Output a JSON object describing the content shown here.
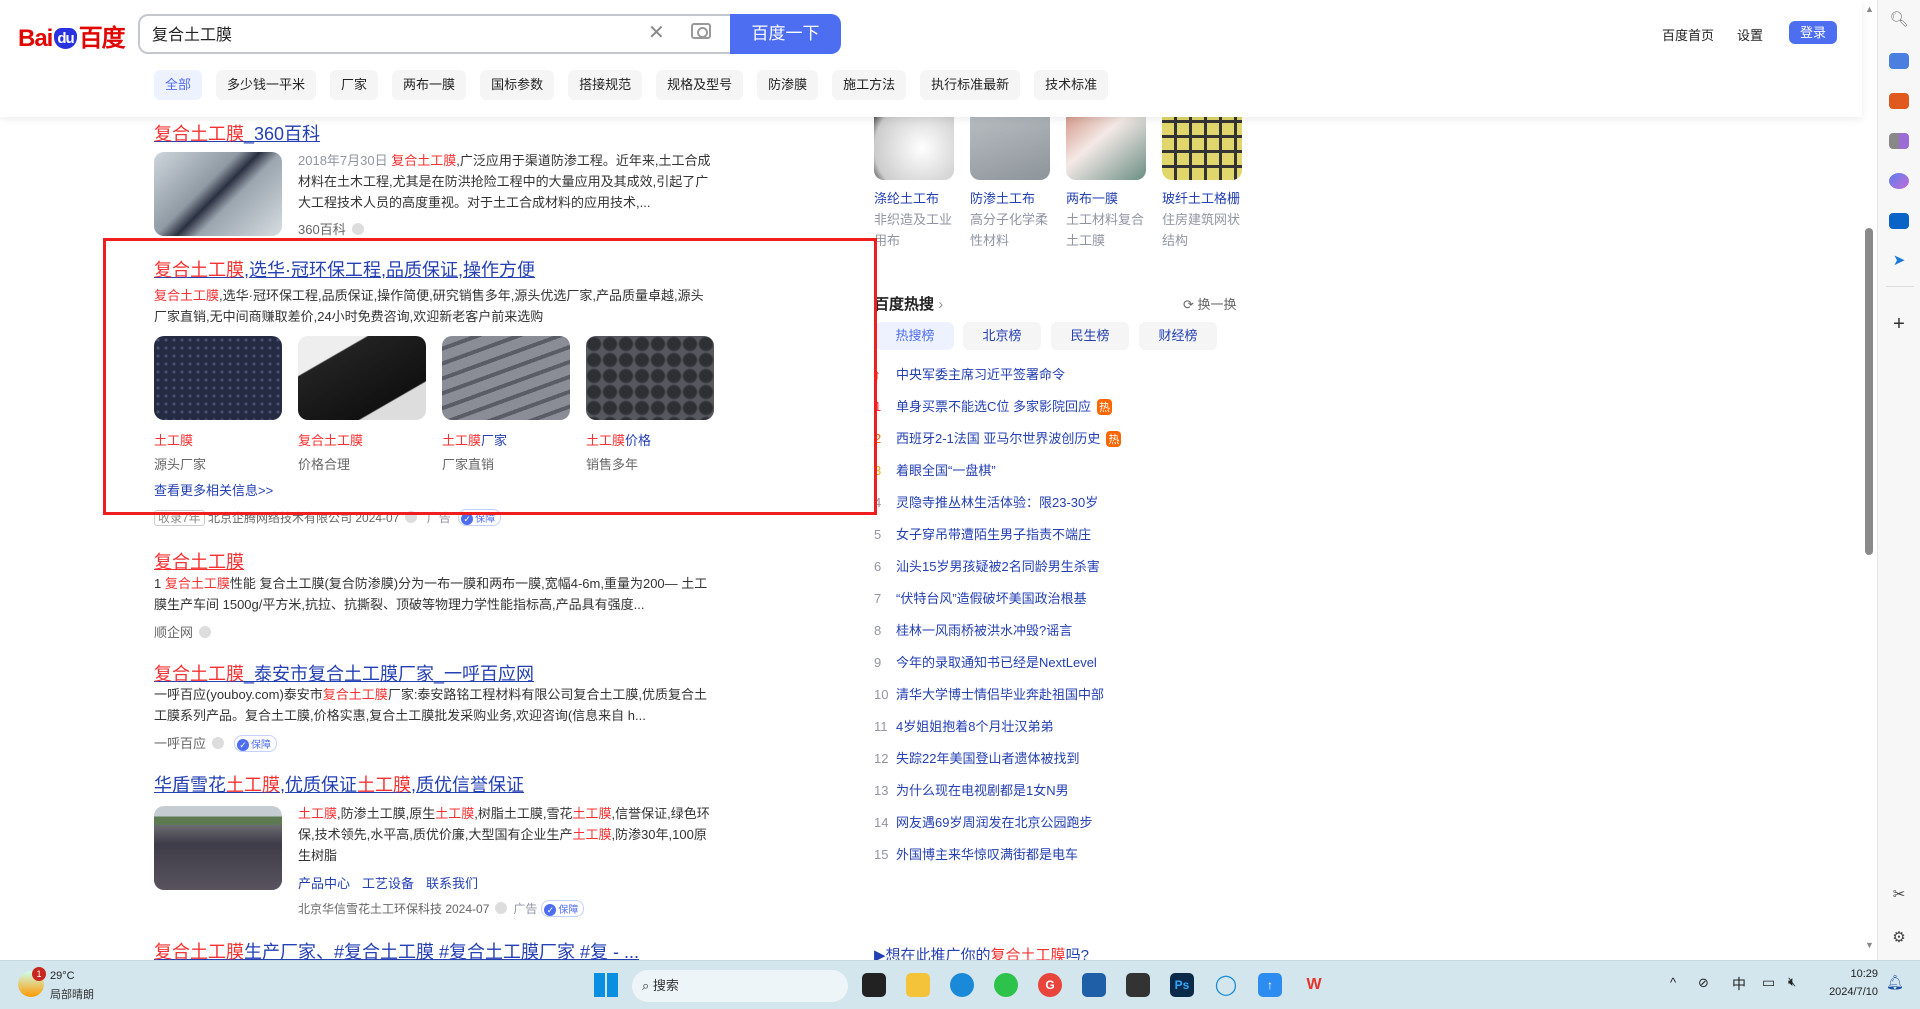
{
  "header": {
    "logo": "Bai du 百度",
    "search_value": "复合土工膜",
    "search_button": "百度一下",
    "links": [
      "百度首页",
      "设置"
    ],
    "login": "登录",
    "tabs": [
      "全部",
      "多少钱一平米",
      "厂家",
      "两布一膜",
      "国标参数",
      "搭接规范",
      "规格及型号",
      "防渗膜",
      "施工方法",
      "执行标准最新",
      "技术标准"
    ]
  },
  "results": {
    "r1": {
      "title_hl": "复合土工膜",
      "title_rest": "_360百科",
      "date": "2018年7月30日",
      "desc_hl": "复合土工膜",
      "desc": ",广泛应用于渠道防渗工程。近年来,土工合成材料在土木工程,尤其是在防洪抢险工程中的大量应用及其成效,引起了广大工程技术人员的高度重视。对于土工合成材料的应用技术,...",
      "source": "360百科"
    },
    "r2": {
      "title_hl": "复合土工膜",
      "title_rest": ",选华·冠环保工程,品质保证,操作方便",
      "desc_hl": "复合土工膜",
      "desc": ",选华·冠环保工程,品质保证,操作简便,研究销售多年,源头优选厂家,产品质量卓越,源头厂家直销,无中间商赚取差价,24小时免费咨询,欢迎新老客户前来选购",
      "cards": [
        {
          "hl": "土工膜",
          "rest": "",
          "sub": "源头厂家"
        },
        {
          "hl": "复合土工膜",
          "rest": "",
          "sub": "价格合理"
        },
        {
          "hl": "土工膜",
          "rest": "厂家",
          "sub": "厂家直销"
        },
        {
          "hl": "土工膜",
          "rest": "价格",
          "sub": "销售多年"
        }
      ],
      "more": "查看更多相关信息>>",
      "years": "收录7年",
      "source": "北京企腾网络技术有限公司 2024-07",
      "ad": "广告",
      "guarantee": "保障"
    },
    "r3": {
      "title": "复合土工膜",
      "desc_pre": "1 ",
      "desc_hl": "复合土工膜",
      "desc": "性能 复合土工膜(复合防渗膜)分为一布一膜和两布一膜,宽幅4-6m,重量为200— 土工膜生产车间 1500g/平方米,抗拉、抗撕裂、顶破等物理力学性能指标高,产品具有强度...",
      "source": "顺企网"
    },
    "r4": {
      "title_hl": "复合土工膜",
      "title_rest": "_泰安市复合土工膜厂家_一呼百应网",
      "desc_pre": "一呼百应(youboy.com)泰安市",
      "desc_hl": "复合土工膜",
      "desc": "厂家:泰安路铭工程材料有限公司复合土工膜,优质复合土工膜系列产品。复合土工膜,价格实惠,复合土工膜批发采购业务,欢迎咨询(信息来自 h...",
      "source": "一呼百应",
      "guarantee": "保障"
    },
    "r5": {
      "t1": "华盾雪花",
      "t2": "土工膜",
      "t3": ",优质保证",
      "t4": "土工膜",
      "t5": ",质优信誉保证",
      "d1": "土工膜",
      "d2": ",防渗土工膜,原生",
      "d3": "土工膜",
      "d4": ",树脂土工膜,雪花",
      "d5": "土工膜",
      "d6": ",信誉保证,绿色环保,技术领先,水平高,质优价廉,大型国有企业生产",
      "d7": "土工膜",
      "d8": ",防渗30年,100原生树脂",
      "links": [
        "产品中心",
        "工艺设备",
        "联系我们"
      ],
      "source": "北京华信雪花土工环保科技 2024-07",
      "ad": "广告",
      "guarantee": "保障"
    },
    "r6": {
      "title_hl": "复合土工膜",
      "title_rest": "生产厂家、#复合土工膜 #复合土工膜厂家 #复 - ..."
    }
  },
  "right": {
    "products": [
      {
        "name": "涤纶土工布",
        "sub": "非织造及工业用布"
      },
      {
        "name": "防渗土工布",
        "sub": "高分子化学柔性材料"
      },
      {
        "name": "两布一膜",
        "sub": "土工材料复合土工膜"
      },
      {
        "name": "玻纤土工格栅",
        "sub": "住房建筑网状结构"
      }
    ],
    "hot_title": "百度热搜",
    "refresh": "换一换",
    "hot_tabs": [
      "热搜榜",
      "北京榜",
      "民生榜",
      "财经榜"
    ],
    "hot_list": [
      {
        "rank": "↑",
        "text": "中央军委主席习近平签署命令"
      },
      {
        "rank": "1",
        "text": "单身买票不能选C位 多家影院回应",
        "badge": "热"
      },
      {
        "rank": "2",
        "text": "西班牙2-1法国 亚马尔世界波创历史",
        "badge": "热"
      },
      {
        "rank": "3",
        "text": "着眼全国“一盘棋”"
      },
      {
        "rank": "4",
        "text": "灵隐寺推丛林生活体验：限23-30岁"
      },
      {
        "rank": "5",
        "text": "女子穿吊带遭陌生男子指责不端庄"
      },
      {
        "rank": "6",
        "text": "汕头15岁男孩疑被2名同龄男生杀害"
      },
      {
        "rank": "7",
        "text": "“伏特台风”造假破坏美国政治根基"
      },
      {
        "rank": "8",
        "text": "桂林一风雨桥被洪水冲毁?谣言"
      },
      {
        "rank": "9",
        "text": "今年的录取通知书已经是NextLevel"
      },
      {
        "rank": "10",
        "text": "清华大学博士情侣毕业奔赴祖国中部"
      },
      {
        "rank": "11",
        "text": "4岁姐姐抱着8个月壮汉弟弟"
      },
      {
        "rank": "12",
        "text": "失踪22年美国登山者遗体被找到"
      },
      {
        "rank": "13",
        "text": "为什么现在电视剧都是1女N男"
      },
      {
        "rank": "14",
        "text": "网友遇69岁周润发在北京公园跑步"
      },
      {
        "rank": "15",
        "text": "外国博主来华惊叹满街都是电车"
      }
    ],
    "promo_pre": "▶想在此推广你的",
    "promo_hl": "复合土工膜",
    "promo_post": "吗?"
  },
  "taskbar": {
    "weather_temp": "29°C",
    "weather_desc": "局部晴朗",
    "weather_badge": "1",
    "search": "搜索",
    "ime": "中",
    "time": "10:29",
    "date": "2024/7/10"
  },
  "colors": {
    "accent": "#4e6ef2",
    "highlight": "#f73131",
    "link": "#2440b3",
    "annotation": "#f01e1e"
  }
}
